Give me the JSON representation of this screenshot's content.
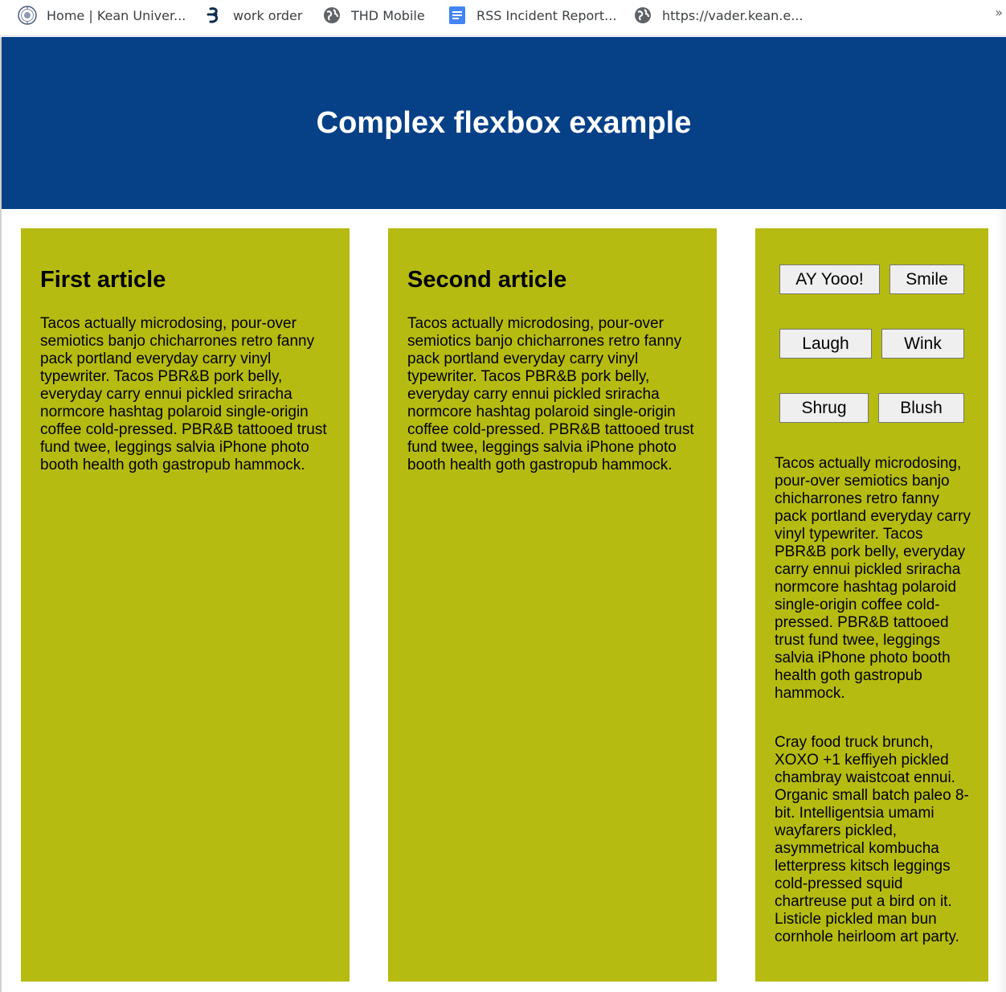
{
  "bookmarks": [
    {
      "label": "Home | Kean Univer...",
      "icon": "kean-seal-icon"
    },
    {
      "label": "work order",
      "icon": "work-order-icon"
    },
    {
      "label": "THD Mobile",
      "icon": "globe-icon"
    },
    {
      "label": "RSS Incident Report...",
      "icon": "google-docs-icon"
    },
    {
      "label": "https://vader.kean.e...",
      "icon": "globe-icon"
    }
  ],
  "bookmarks_more": "»",
  "header": {
    "title": "Complex flexbox example",
    "background": "#064087"
  },
  "articles": [
    {
      "heading": "First article",
      "body": "Tacos actually microdosing, pour-over semiotics banjo chicharrones retro fanny pack portland everyday carry vinyl typewriter. Tacos PBR&B pork belly, everyday carry ennui pickled sriracha normcore hashtag polaroid single-origin coffee cold-pressed. PBR&B tattooed trust fund twee, leggings salvia iPhone photo booth health goth gastropub hammock."
    },
    {
      "heading": "Second article",
      "body": "Tacos actually microdosing, pour-over semiotics banjo chicharrones retro fanny pack portland everyday carry vinyl typewriter. Tacos PBR&B pork belly, everyday carry ennui pickled sriracha normcore hashtag polaroid single-origin coffee cold-pressed. PBR&B tattooed trust fund twee, leggings salvia iPhone photo booth health goth gastropub hammock."
    }
  ],
  "third_column": {
    "buttons": [
      "AY Yooo!",
      "Smile",
      "Laugh",
      "Wink",
      "Shrug",
      "Blush"
    ],
    "paragraph1": "Tacos actually microdosing, pour-over semiotics banjo chicharrones retro fanny pack portland everyday carry vinyl typewriter. Tacos PBR&B pork belly, everyday carry ennui pickled sriracha normcore hashtag polaroid single-origin coffee cold-pressed. PBR&B tattooed trust fund twee, leggings salvia iPhone photo booth health goth gastropub hammock.",
    "paragraph2": "Cray food truck brunch, XOXO +1 keffiyeh pickled chambray waistcoat ennui. Organic small batch paleo 8-bit. Intelligentsia umami wayfarers pickled, asymmetrical kombucha letterpress kitsch leggings cold-pressed squid chartreuse put a bird on it. Listicle pickled man bun cornhole heirloom art party."
  },
  "colors": {
    "column_background": "#b6bb11",
    "header_background": "#064087"
  }
}
